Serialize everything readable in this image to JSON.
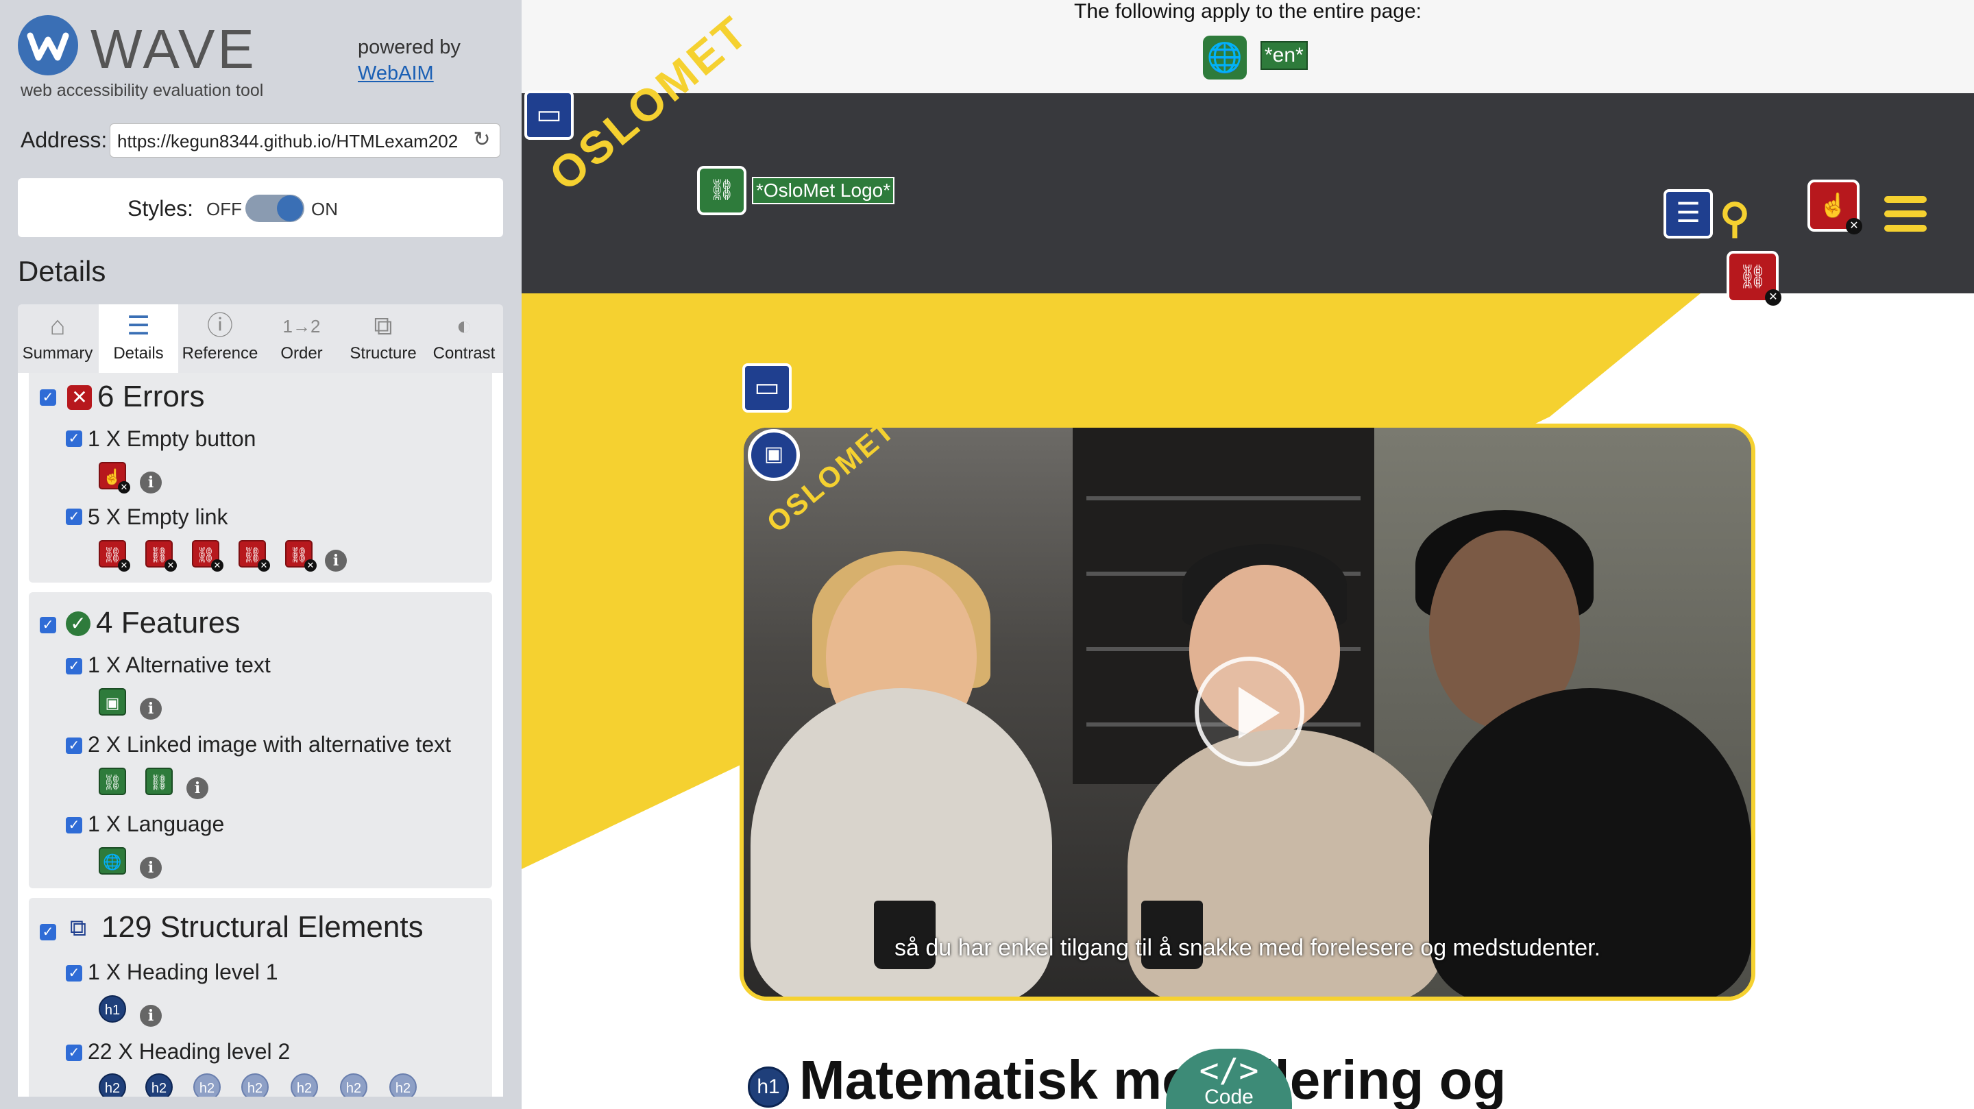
{
  "wave": {
    "title": "WAVE",
    "subtitle": "web accessibility evaluation tool",
    "powered_by": "powered by",
    "webaim_link": "WebAIM",
    "address_label": "Address:",
    "address_value": "https://kegun8344.github.io/HTMLexam202",
    "styles_label": "Styles:",
    "styles_off": "OFF",
    "styles_on": "ON",
    "details_heading": "Details"
  },
  "tabs": [
    {
      "label": "Summary",
      "icon": "home-icon"
    },
    {
      "label": "Details",
      "icon": "list-icon",
      "active": true
    },
    {
      "label": "Reference",
      "icon": "info-icon"
    },
    {
      "label": "Order",
      "icon": "order-icon"
    },
    {
      "label": "Structure",
      "icon": "structure-icon"
    },
    {
      "label": "Contrast",
      "icon": "contrast-icon"
    }
  ],
  "groups": {
    "errors": {
      "heading": "6 Errors",
      "items": [
        {
          "label": "1 X Empty button"
        },
        {
          "label": "5 X Empty link"
        }
      ]
    },
    "features": {
      "heading": "4 Features",
      "items": [
        {
          "label": "1 X Alternative text"
        },
        {
          "label": "2 X Linked image with alternative text"
        },
        {
          "label": "1 X Language"
        }
      ]
    },
    "structure": {
      "heading": "129 Structural Elements",
      "items": [
        {
          "label": "1 X Heading level 1"
        },
        {
          "label": "22 X Heading level 2"
        }
      ],
      "h1_badge": "h1",
      "h2_badge": "h2"
    }
  },
  "page": {
    "apply_text": "The following apply to the entire page:",
    "lang_tag": "*en*",
    "logo_text": "OSLOMET",
    "logo_alt": "*OsloMet Logo*",
    "video_caption": "så du har enkel tilgang til å snakke med forelesere og medstudenter.",
    "h1_badge": "h1",
    "h1_text": "Matematisk modellering og",
    "code_symbol": "</>",
    "code_label": "Code"
  },
  "colors": {
    "brand_yellow": "#f5d130",
    "header_dark": "#38393d",
    "error_red": "#b7181d",
    "feature_green": "#2e7b3b",
    "structure_blue": "#1f3f8f"
  }
}
